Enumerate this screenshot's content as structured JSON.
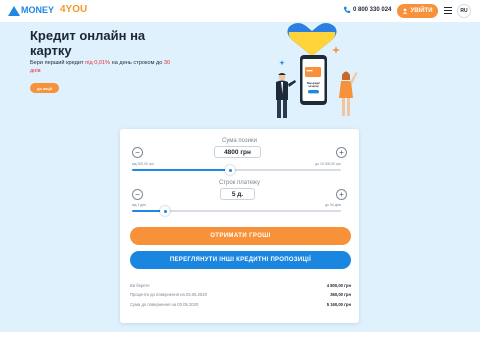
{
  "header": {
    "logo_part1": "MONEY",
    "logo_part2": "4YOU",
    "phone": "0 800 330 024",
    "login_label": "УВІЙТИ",
    "lang": "RU"
  },
  "hero": {
    "title": "Кредит онлайн на картку",
    "sub_before": "Бери перший кредит ",
    "sub_highlight1": "під 0,01%",
    "sub_middle": " на день строком до ",
    "sub_highlight2": "30 днів",
    "promo_button": "до акції",
    "phone_screen_text": "Ваш кредит на картці"
  },
  "calculator": {
    "amount_label": "Сума позики",
    "amount_value": "4800 грн",
    "amount_min": "від 300.00 грн",
    "amount_max": "до 10 000.00 грн",
    "amount_fraction": 0.47,
    "term_label": "Строк платежу",
    "term_value": "5 д.",
    "term_min": "від 1 дня",
    "term_max": "до 30 днів",
    "term_fraction": 0.16,
    "minus": "−",
    "plus": "+",
    "get_money_button": "ОТРИМАТИ ГРОШІ",
    "other_offers_button": "ПЕРЕГЛЯНУТИ ІНШІ КРЕДИТНІ ПРОПОЗИЦІЇ",
    "summary": [
      {
        "label": "Ви берете",
        "value": "4 800,00 грн"
      },
      {
        "label": "Проценти до повернення на 03.05.2020",
        "value": "360,00 грн"
      },
      {
        "label": "Сума до повернення на 03.05.2020",
        "value": "5 160,00 грн"
      }
    ]
  },
  "colors": {
    "accent_orange": "#f7923a",
    "accent_blue": "#1e88e5",
    "background": "#dff1fc"
  }
}
